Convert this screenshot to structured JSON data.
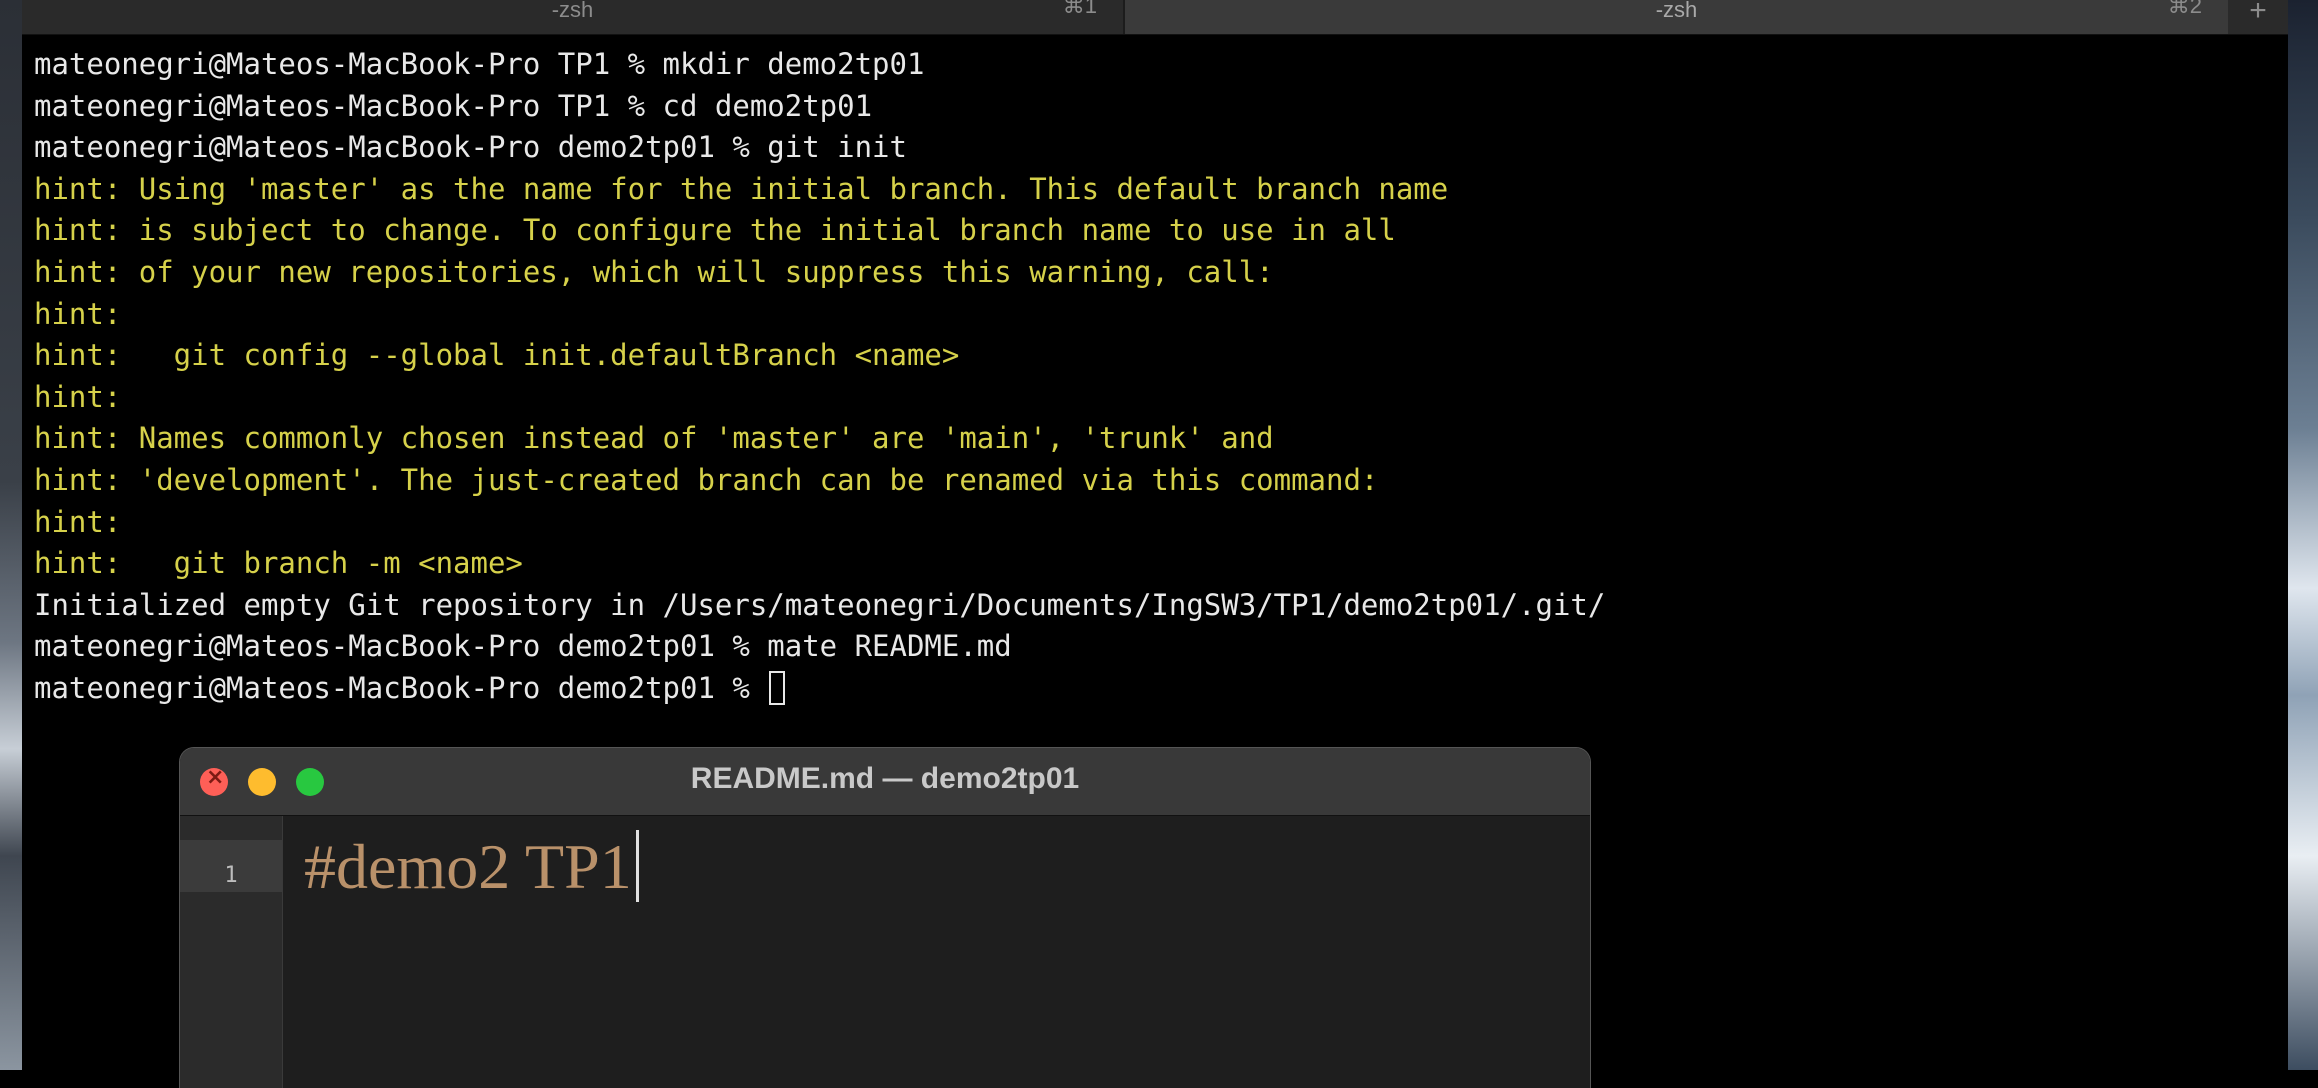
{
  "terminal": {
    "tabs": [
      {
        "title": "-zsh",
        "shortcut": "⌘1"
      },
      {
        "title": "-zsh",
        "shortcut": "⌘2"
      }
    ],
    "new_tab_label": "+",
    "lines": [
      {
        "text": "mateonegri@Mateos-MacBook-Pro TP1 % mkdir demo2tp01",
        "kind": "out"
      },
      {
        "text": "mateonegri@Mateos-MacBook-Pro TP1 % cd demo2tp01",
        "kind": "out"
      },
      {
        "text": "mateonegri@Mateos-MacBook-Pro demo2tp01 % git init",
        "kind": "out"
      },
      {
        "text": "hint: Using 'master' as the name for the initial branch. This default branch name",
        "kind": "hint"
      },
      {
        "text": "hint: is subject to change. To configure the initial branch name to use in all",
        "kind": "hint"
      },
      {
        "text": "hint: of your new repositories, which will suppress this warning, call:",
        "kind": "hint"
      },
      {
        "text": "hint:",
        "kind": "hint"
      },
      {
        "text": "hint:   git config --global init.defaultBranch <name>",
        "kind": "hint"
      },
      {
        "text": "hint:",
        "kind": "hint"
      },
      {
        "text": "hint: Names commonly chosen instead of 'master' are 'main', 'trunk' and",
        "kind": "hint"
      },
      {
        "text": "hint: 'development'. The just-created branch can be renamed via this command:",
        "kind": "hint"
      },
      {
        "text": "hint:",
        "kind": "hint"
      },
      {
        "text": "hint:   git branch -m <name>",
        "kind": "hint"
      },
      {
        "text": "Initialized empty Git repository in /Users/mateonegri/Documents/IngSW3/TP1/demo2tp01/.git/",
        "kind": "out"
      },
      {
        "text": "mateonegri@Mateos-MacBook-Pro demo2tp01 % mate README.md",
        "kind": "out"
      }
    ],
    "prompt": "mateonegri@Mateos-MacBook-Pro demo2tp01 % "
  },
  "editor": {
    "title": "README.md — demo2tp01",
    "line_number": "1",
    "content": "#demo2 TP1"
  },
  "colors": {
    "hint_text": "#d6d14a",
    "output_text": "#e8e8e8",
    "editor_text": "#b9916a"
  }
}
